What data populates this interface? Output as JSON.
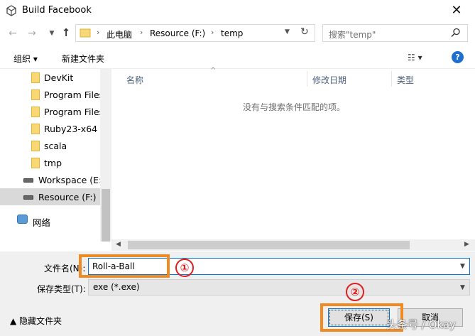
{
  "window": {
    "title": "Build Facebook"
  },
  "address": {
    "crumbs": [
      "此电脑",
      "Resource (F:)",
      "temp"
    ]
  },
  "search": {
    "placeholder": "搜索\"temp\""
  },
  "toolbar": {
    "organize": "组织 ▾",
    "new_folder": "新建文件夹",
    "view_icon": "☷ ▾",
    "help": "?"
  },
  "tree": {
    "items": [
      "DevKit",
      "Program Files",
      "Program Files",
      "Ruby23-x64",
      "scala",
      "tmp"
    ],
    "drives": [
      "Workspace (E:)",
      "Resource (F:)"
    ],
    "network": "网络"
  },
  "filelist": {
    "columns": [
      "名称",
      "修改日期",
      "类型"
    ],
    "empty_message": "没有与搜索条件匹配的项。"
  },
  "form": {
    "filename_label": "文件名(N):",
    "filename_value": "Roll-a-Ball",
    "filetype_label": "保存类型(T):",
    "filetype_value": "exe (*.exe)",
    "hide_folders": "▲ 隐藏文件夹",
    "save": "保存(S)",
    "cancel": "取消"
  },
  "annotations": {
    "marker1": "①",
    "marker2": "②",
    "watermark": "头条号 / Okay"
  },
  "colors": {
    "accent": "#0078d7",
    "highlight": "#f08b24",
    "marker": "#e02020",
    "help": "#1e6fd0"
  }
}
